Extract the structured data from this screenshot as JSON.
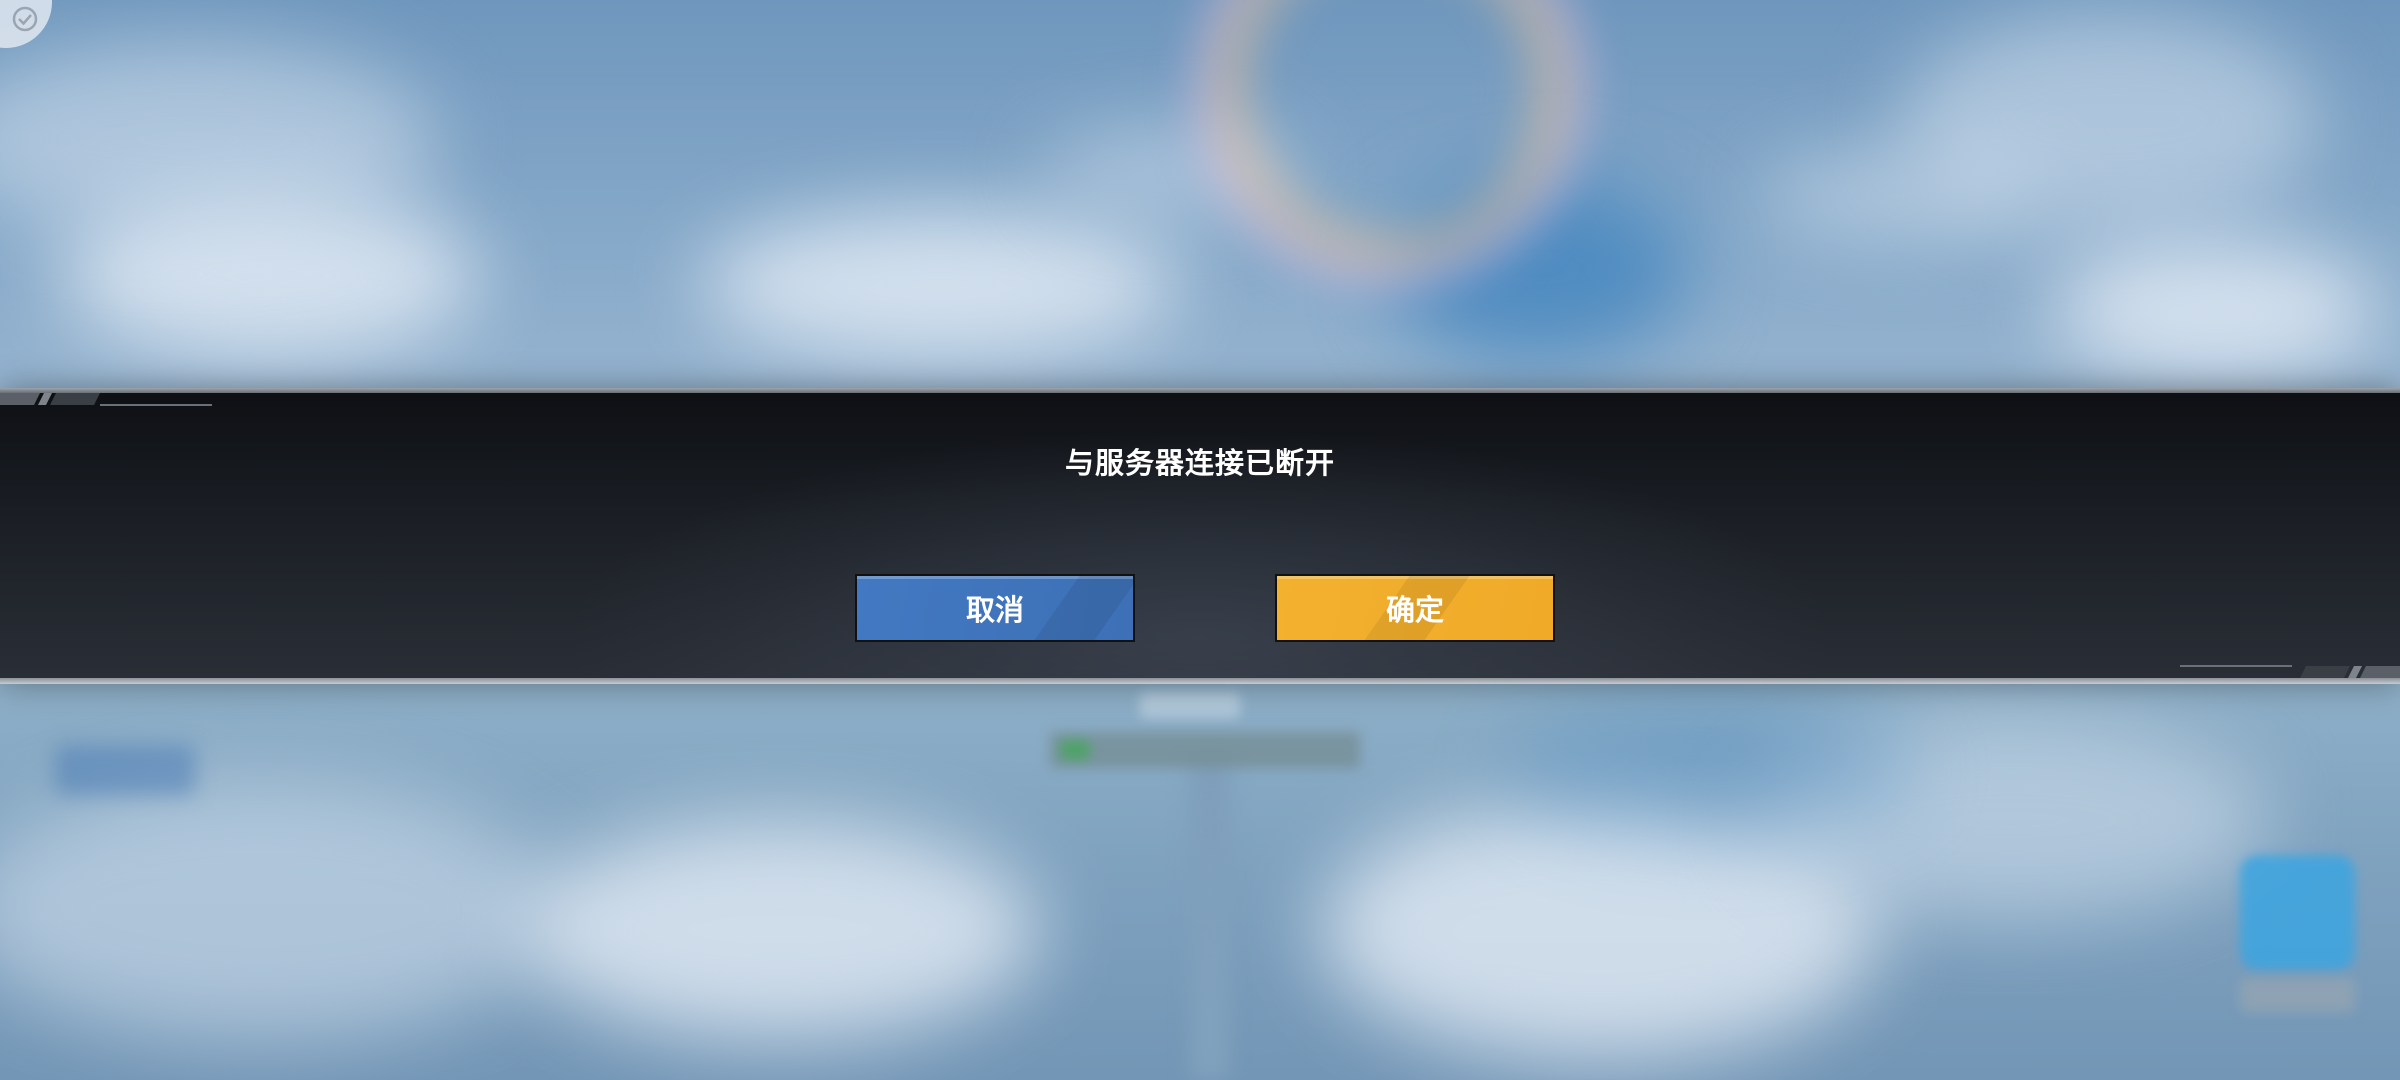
{
  "dialog": {
    "message": "与服务器连接已断开",
    "cancel_label": "取消",
    "confirm_label": "确定"
  },
  "colors": {
    "cancel_button": "#4279c2",
    "confirm_button": "#f2b12f",
    "dialog_background": "#1b1f25",
    "text": "#ffffff"
  },
  "icons": {
    "corner": "check-circle-icon"
  }
}
